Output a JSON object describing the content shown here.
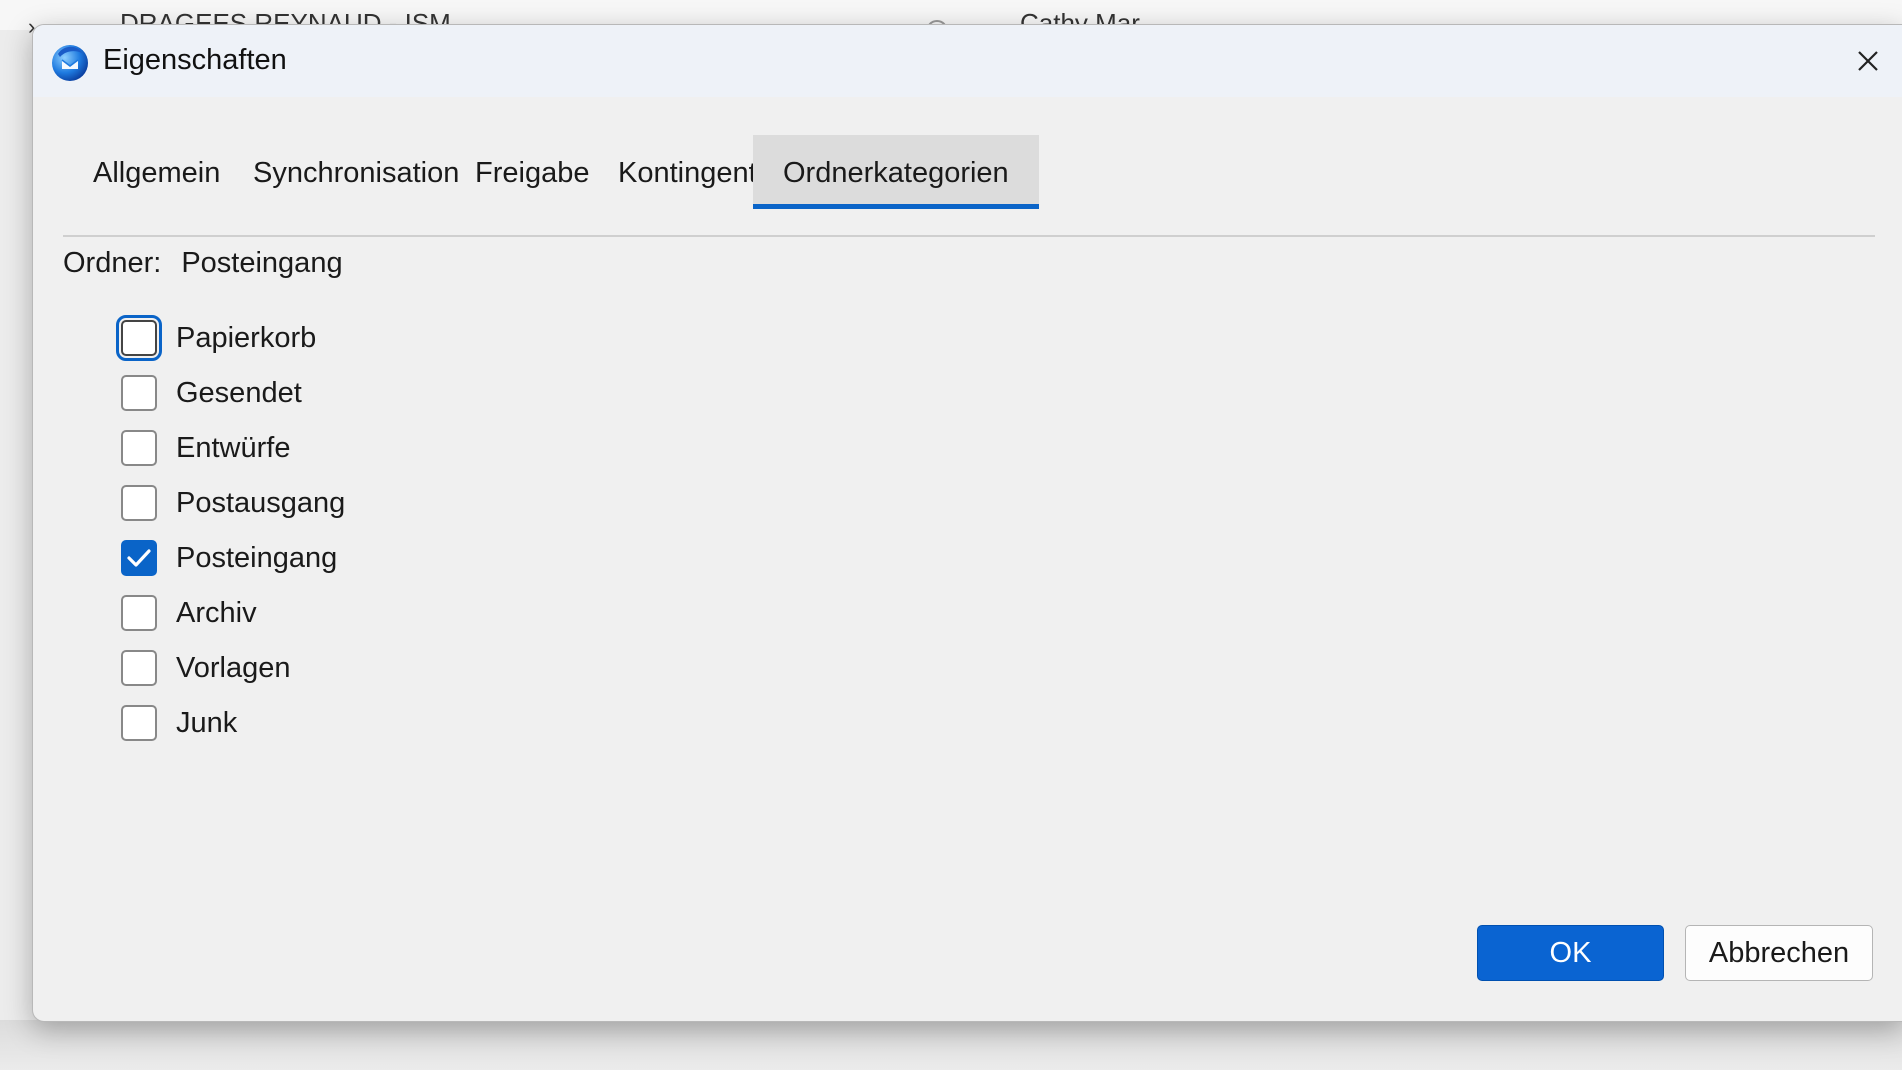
{
  "window": {
    "title": "Eigenschaften"
  },
  "background": {
    "partial_text": "DRAGEES REYNAUD - ISM",
    "partial_text_2": "Cathy Mar"
  },
  "tabs": [
    {
      "label": "Allgemein"
    },
    {
      "label": "Synchronisation"
    },
    {
      "label": "Freigabe"
    },
    {
      "label": "Kontingent"
    },
    {
      "label": "Ordnerkategorien",
      "active": true
    }
  ],
  "folder": {
    "label": "Ordner:",
    "value": "Posteingang"
  },
  "categories": [
    {
      "label": "Papierkorb",
      "checked": false,
      "focused": true
    },
    {
      "label": "Gesendet",
      "checked": false
    },
    {
      "label": "Entwürfe",
      "checked": false
    },
    {
      "label": "Postausgang",
      "checked": false
    },
    {
      "label": "Posteingang",
      "checked": true
    },
    {
      "label": "Archiv",
      "checked": false
    },
    {
      "label": "Vorlagen",
      "checked": false
    },
    {
      "label": "Junk",
      "checked": false
    }
  ],
  "buttons": {
    "ok": "OK",
    "cancel": "Abbrechen"
  },
  "colors": {
    "accent": "#0a64c8",
    "dialog_bg": "#f0f0f0",
    "titlebar_bg": "#eef2f8"
  },
  "icons": {
    "app": "thunderbird-icon",
    "close": "close-icon",
    "check": "checkmark-icon"
  }
}
